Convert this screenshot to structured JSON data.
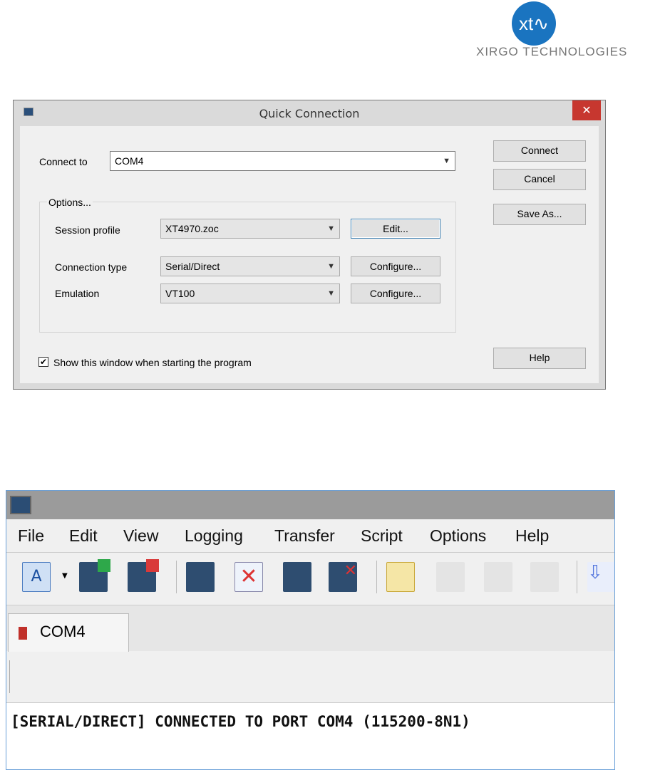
{
  "logo": {
    "mark": "xt",
    "text": "XIRGO TECHNOLOGIES"
  },
  "dialog": {
    "title": "Quick Connection",
    "close": "✕",
    "connect_to_label": "Connect to",
    "connect_to_value": "COM4",
    "options_label": "Options...",
    "session_profile_label": "Session profile",
    "session_profile_value": "XT4970.zoc",
    "edit_button": "Edit...",
    "connection_type_label": "Connection type",
    "connection_type_value": "Serial/Direct",
    "configure1": "Configure...",
    "emulation_label": "Emulation",
    "emulation_value": "VT100",
    "configure2": "Configure...",
    "show_window_label": "Show this window when starting the program",
    "show_window_checked": true,
    "connect_button": "Connect",
    "cancel_button": "Cancel",
    "save_as_button": "Save As...",
    "help_button": "Help"
  },
  "terminal": {
    "menu": [
      "File",
      "Edit",
      "View",
      "Logging",
      "Transfer",
      "Script",
      "Options",
      "Help"
    ],
    "tab_label": "COM4",
    "output": "[SERIAL/DIRECT] CONNECTED TO PORT COM4 (115200-8N1)"
  }
}
